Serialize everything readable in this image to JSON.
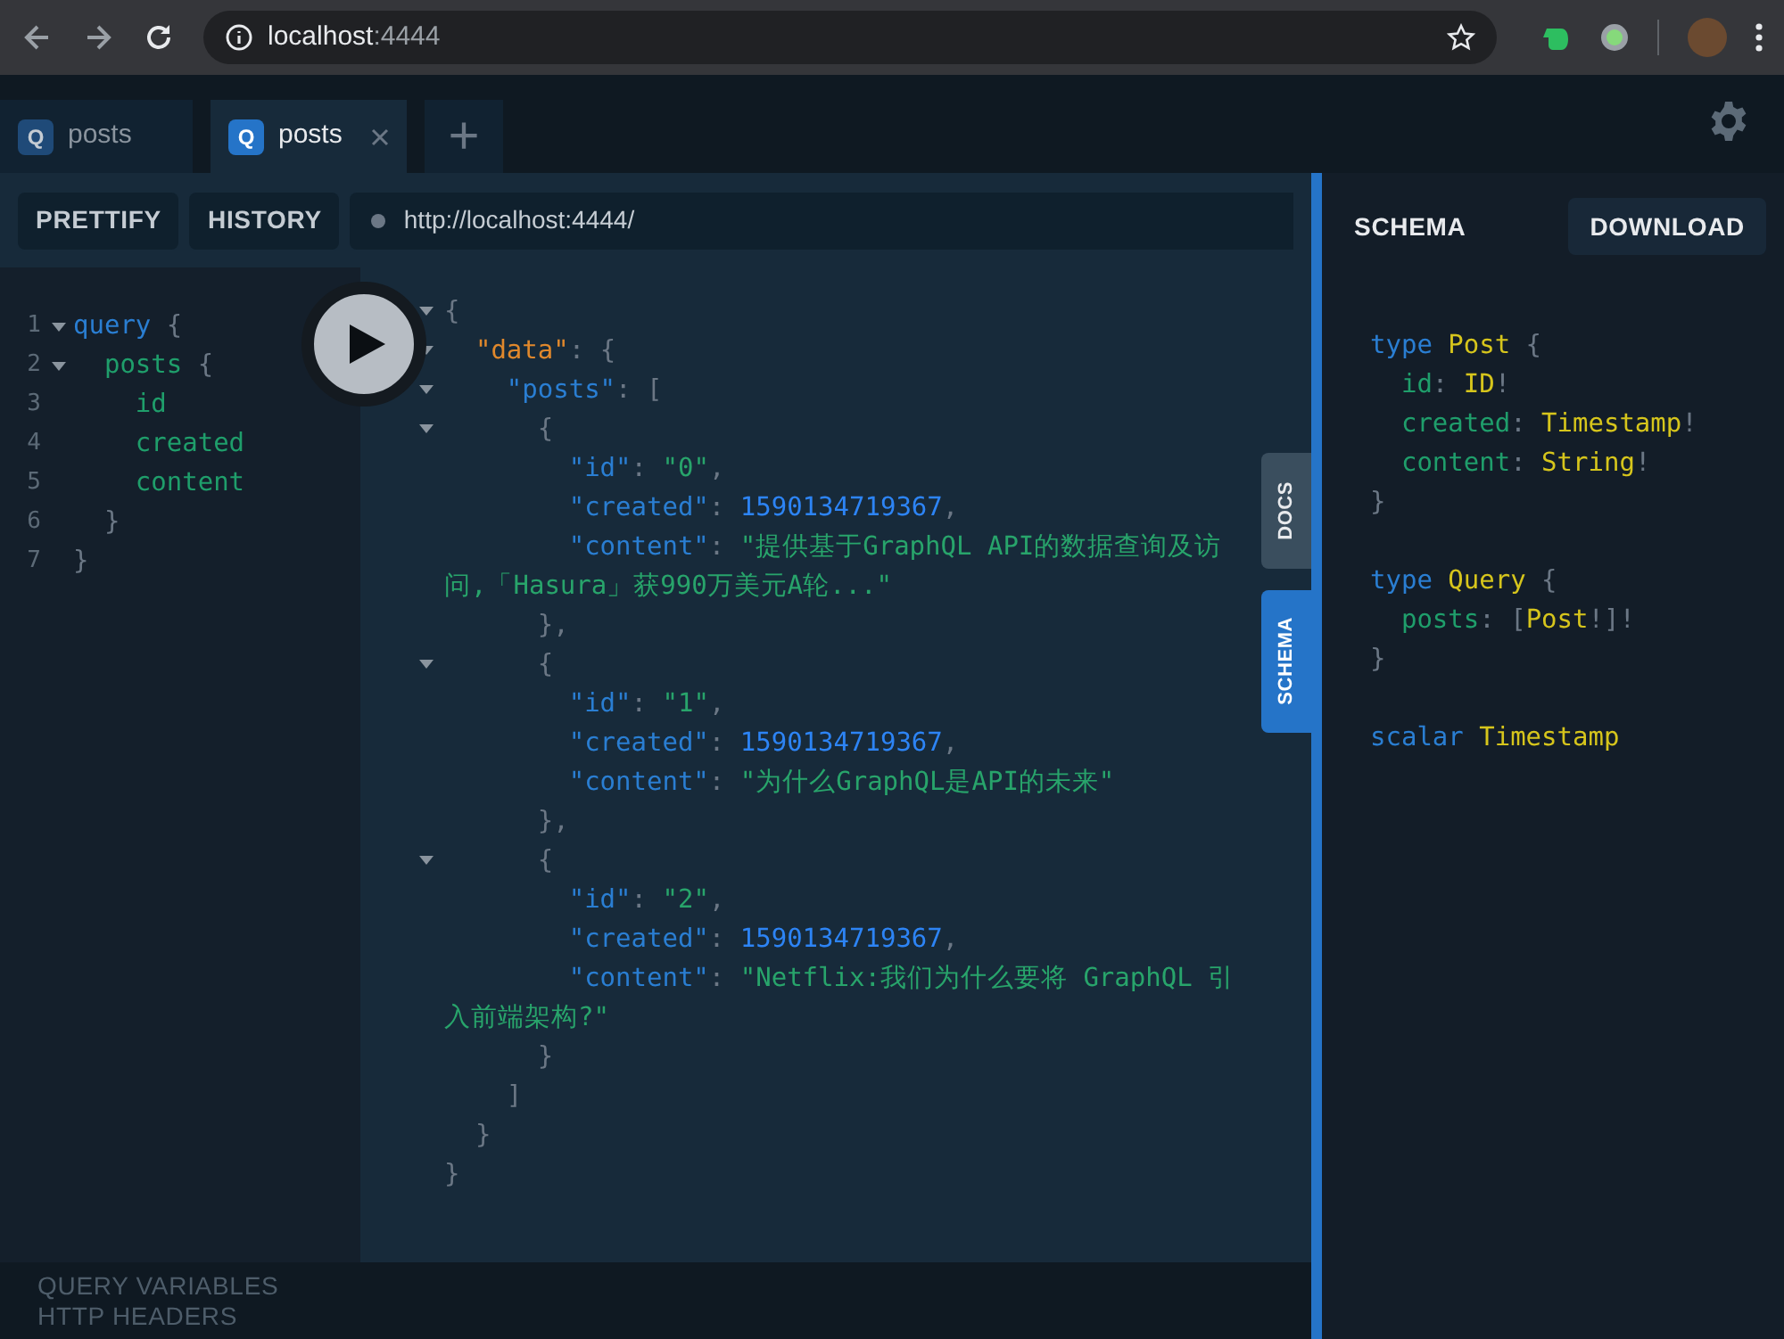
{
  "browser": {
    "address": {
      "host": "localhost",
      "port": ":4444"
    }
  },
  "tabs": [
    {
      "badge": "Q",
      "label": "posts",
      "selected": false
    },
    {
      "badge": "Q",
      "label": "posts",
      "selected": true
    }
  ],
  "add_tab": "+",
  "toolbar": {
    "buttons": [
      "PRETTIFY",
      "HISTORY"
    ],
    "endpoint": "http://localhost:4444/"
  },
  "query_editor": {
    "lines": [
      {
        "number": "1",
        "foldable": true,
        "tokens": [
          {
            "kind": "keyword",
            "text": "query"
          },
          {
            "kind": "punct",
            "text": " {"
          }
        ]
      },
      {
        "number": "2",
        "foldable": true,
        "tokens": [
          {
            "kind": "field",
            "text": "  posts"
          },
          {
            "kind": "punct",
            "text": " {"
          }
        ]
      },
      {
        "number": "3",
        "foldable": false,
        "tokens": [
          {
            "kind": "field",
            "text": "    id"
          }
        ]
      },
      {
        "number": "4",
        "foldable": false,
        "tokens": [
          {
            "kind": "field",
            "text": "    created"
          }
        ]
      },
      {
        "number": "5",
        "foldable": false,
        "tokens": [
          {
            "kind": "field",
            "text": "    content"
          }
        ]
      },
      {
        "number": "6",
        "foldable": false,
        "tokens": [
          {
            "kind": "punct",
            "text": "  }"
          }
        ]
      },
      {
        "number": "7",
        "foldable": false,
        "tokens": [
          {
            "kind": "punct",
            "text": "}"
          }
        ]
      }
    ]
  },
  "result": {
    "lines": [
      {
        "foldable": true,
        "tokens": [
          {
            "kind": "punct",
            "text": "{"
          }
        ]
      },
      {
        "foldable": true,
        "tokens": [
          {
            "kind": "datakey",
            "text": "  \"data\""
          },
          {
            "kind": "punct",
            "text": ": {"
          }
        ]
      },
      {
        "foldable": true,
        "tokens": [
          {
            "kind": "key",
            "text": "    \"posts\""
          },
          {
            "kind": "punct",
            "text": ": ["
          }
        ]
      },
      {
        "foldable": true,
        "tokens": [
          {
            "kind": "punct",
            "text": "      {"
          }
        ]
      },
      {
        "foldable": false,
        "tokens": [
          {
            "kind": "key",
            "text": "        \"id\""
          },
          {
            "kind": "punct",
            "text": ": "
          },
          {
            "kind": "string",
            "text": "\"0\""
          },
          {
            "kind": "punct",
            "text": ","
          }
        ]
      },
      {
        "foldable": false,
        "tokens": [
          {
            "kind": "key",
            "text": "        \"created\""
          },
          {
            "kind": "punct",
            "text": ": "
          },
          {
            "kind": "number",
            "text": "1590134719367"
          },
          {
            "kind": "punct",
            "text": ","
          }
        ]
      },
      {
        "foldable": false,
        "tokens": [
          {
            "kind": "key",
            "text": "        \"content\""
          },
          {
            "kind": "punct",
            "text": ": "
          },
          {
            "kind": "string",
            "text": "\"提供基于GraphQL API的数据查询及访问,「Hasura」获990万美元A轮...\""
          }
        ]
      },
      {
        "foldable": false,
        "tokens": [
          {
            "kind": "punct",
            "text": "      },"
          }
        ]
      },
      {
        "foldable": true,
        "tokens": [
          {
            "kind": "punct",
            "text": "      {"
          }
        ]
      },
      {
        "foldable": false,
        "tokens": [
          {
            "kind": "key",
            "text": "        \"id\""
          },
          {
            "kind": "punct",
            "text": ": "
          },
          {
            "kind": "string",
            "text": "\"1\""
          },
          {
            "kind": "punct",
            "text": ","
          }
        ]
      },
      {
        "foldable": false,
        "tokens": [
          {
            "kind": "key",
            "text": "        \"created\""
          },
          {
            "kind": "punct",
            "text": ": "
          },
          {
            "kind": "number",
            "text": "1590134719367"
          },
          {
            "kind": "punct",
            "text": ","
          }
        ]
      },
      {
        "foldable": false,
        "tokens": [
          {
            "kind": "key",
            "text": "        \"content\""
          },
          {
            "kind": "punct",
            "text": ": "
          },
          {
            "kind": "string",
            "text": "\"为什么GraphQL是API的未来\""
          }
        ]
      },
      {
        "foldable": false,
        "tokens": [
          {
            "kind": "punct",
            "text": "      },"
          }
        ]
      },
      {
        "foldable": true,
        "tokens": [
          {
            "kind": "punct",
            "text": "      {"
          }
        ]
      },
      {
        "foldable": false,
        "tokens": [
          {
            "kind": "key",
            "text": "        \"id\""
          },
          {
            "kind": "punct",
            "text": ": "
          },
          {
            "kind": "string",
            "text": "\"2\""
          },
          {
            "kind": "punct",
            "text": ","
          }
        ]
      },
      {
        "foldable": false,
        "tokens": [
          {
            "kind": "key",
            "text": "        \"created\""
          },
          {
            "kind": "punct",
            "text": ": "
          },
          {
            "kind": "number",
            "text": "1590134719367"
          },
          {
            "kind": "punct",
            "text": ","
          }
        ]
      },
      {
        "foldable": false,
        "tokens": [
          {
            "kind": "key",
            "text": "        \"content\""
          },
          {
            "kind": "punct",
            "text": ": "
          },
          {
            "kind": "string",
            "text": "\"Netflix:我们为什么要将 GraphQL 引入前端架构?\""
          }
        ]
      },
      {
        "foldable": false,
        "tokens": [
          {
            "kind": "punct",
            "text": "      }"
          }
        ]
      },
      {
        "foldable": false,
        "tokens": [
          {
            "kind": "punct",
            "text": "    ]"
          }
        ]
      },
      {
        "foldable": false,
        "tokens": [
          {
            "kind": "punct",
            "text": "  }"
          }
        ]
      },
      {
        "foldable": false,
        "tokens": [
          {
            "kind": "punct",
            "text": "}"
          }
        ]
      }
    ]
  },
  "side_tabs": [
    {
      "label": "DOCS",
      "selected": false
    },
    {
      "label": "SCHEMA",
      "selected": true
    }
  ],
  "schema_panel": {
    "title": "SCHEMA",
    "download": "DOWNLOAD",
    "definitions": [
      {
        "lines": [
          {
            "tokens": [
              {
                "kind": "keyword",
                "text": "type"
              },
              {
                "kind": "type",
                "text": " Post"
              },
              {
                "kind": "punct",
                "text": " {"
              }
            ]
          },
          {
            "tokens": [
              {
                "kind": "field",
                "text": "  id"
              },
              {
                "kind": "punct",
                "text": ": "
              },
              {
                "kind": "type",
                "text": "ID"
              },
              {
                "kind": "punct",
                "text": "!"
              }
            ]
          },
          {
            "tokens": [
              {
                "kind": "field",
                "text": "  created"
              },
              {
                "kind": "punct",
                "text": ": "
              },
              {
                "kind": "type",
                "text": "Timestamp"
              },
              {
                "kind": "punct",
                "text": "!"
              }
            ]
          },
          {
            "tokens": [
              {
                "kind": "field",
                "text": "  content"
              },
              {
                "kind": "punct",
                "text": ": "
              },
              {
                "kind": "type",
                "text": "String"
              },
              {
                "kind": "punct",
                "text": "!"
              }
            ]
          },
          {
            "tokens": [
              {
                "kind": "punct",
                "text": "}"
              }
            ]
          }
        ]
      },
      {
        "lines": [
          {
            "tokens": [
              {
                "kind": "keyword",
                "text": "type"
              },
              {
                "kind": "type",
                "text": " Query"
              },
              {
                "kind": "punct",
                "text": " {"
              }
            ]
          },
          {
            "tokens": [
              {
                "kind": "field",
                "text": "  posts"
              },
              {
                "kind": "punct",
                "text": ": ["
              },
              {
                "kind": "type",
                "text": "Post"
              },
              {
                "kind": "punct",
                "text": "!]!"
              }
            ]
          },
          {
            "tokens": [
              {
                "kind": "punct",
                "text": "}"
              }
            ]
          }
        ]
      },
      {
        "lines": [
          {
            "tokens": [
              {
                "kind": "keyword",
                "text": "scalar"
              },
              {
                "kind": "type",
                "text": " Timestamp"
              }
            ]
          }
        ]
      }
    ]
  },
  "bottom_panels": [
    "QUERY VARIABLES",
    "HTTP HEADERS"
  ]
}
